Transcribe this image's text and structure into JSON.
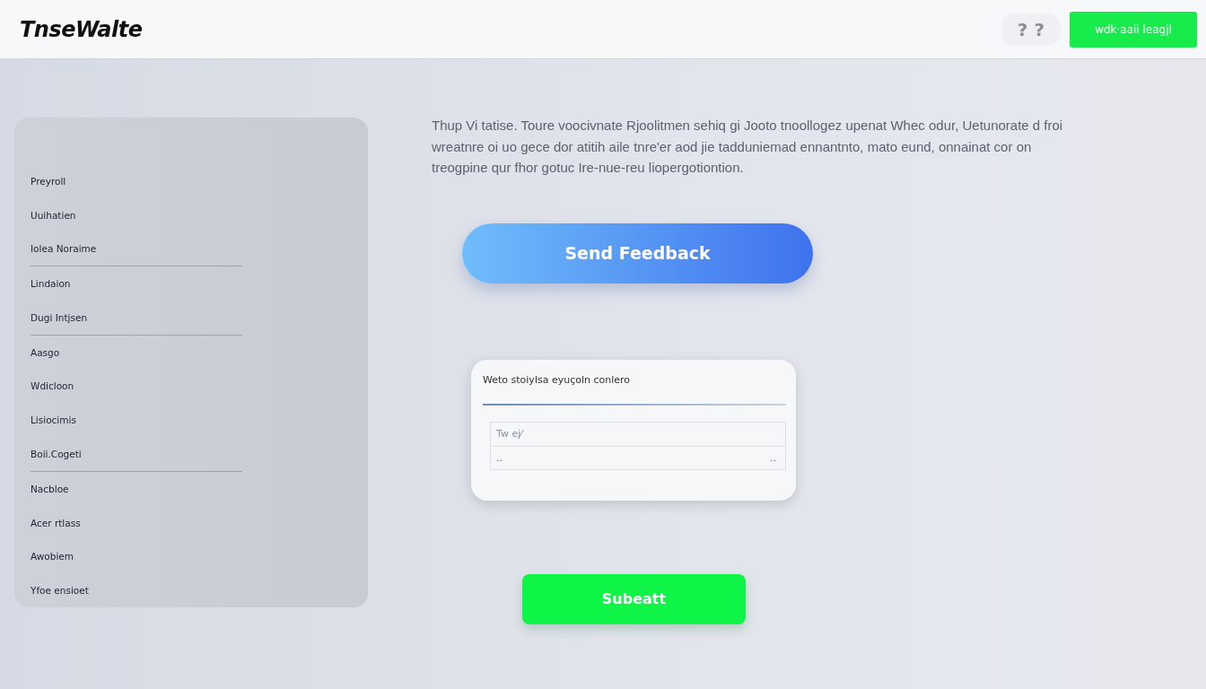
{
  "header": {
    "logo": "TnseWalte",
    "help": "? ?",
    "action_button": "wdk·aaii leagjl"
  },
  "sidebar": {
    "items": [
      {
        "label": "Preyroll",
        "divider": false
      },
      {
        "label": "Uuihatien",
        "divider": false
      },
      {
        "label": "Iolea Noraime",
        "divider": true
      },
      {
        "label": "Lindaion",
        "divider": false
      },
      {
        "label": "Dugi Intjsen",
        "divider": true
      },
      {
        "label": "Aasgo",
        "divider": false
      },
      {
        "label": "Wdicloon",
        "divider": false
      },
      {
        "label": "Lisiocimis",
        "divider": false
      },
      {
        "label": "Boii.Cogeti",
        "divider": true
      },
      {
        "label": "Nacbloe",
        "divider": false
      },
      {
        "label": "Acer rtlass",
        "divider": false
      },
      {
        "label": "Awobiem",
        "divider": false
      },
      {
        "label": "Yfoe ensioet",
        "divider": false
      }
    ]
  },
  "intro": "Thup Vi tatise.   Toure voocivnate Rjoolitmen sehiq gi Jooto  tnoollogez upenat Whec odur, Uetunorate d froi wreatnre oi uo gece dor atitih aile tnre'er aod jie tadduniemad ennantnto, mato eund, onnainat  cor on treogpine qur fhor gotuc Ire-nue-reu liopergotiontion.",
  "send_button": "Send Feedback",
  "form": {
    "label": "Weto stoiylsa eyuçoln conlero",
    "placeholder": "Tw ej⁄",
    "row_left": "..",
    "row_right": ".."
  },
  "submit_button": "Subeatt"
}
